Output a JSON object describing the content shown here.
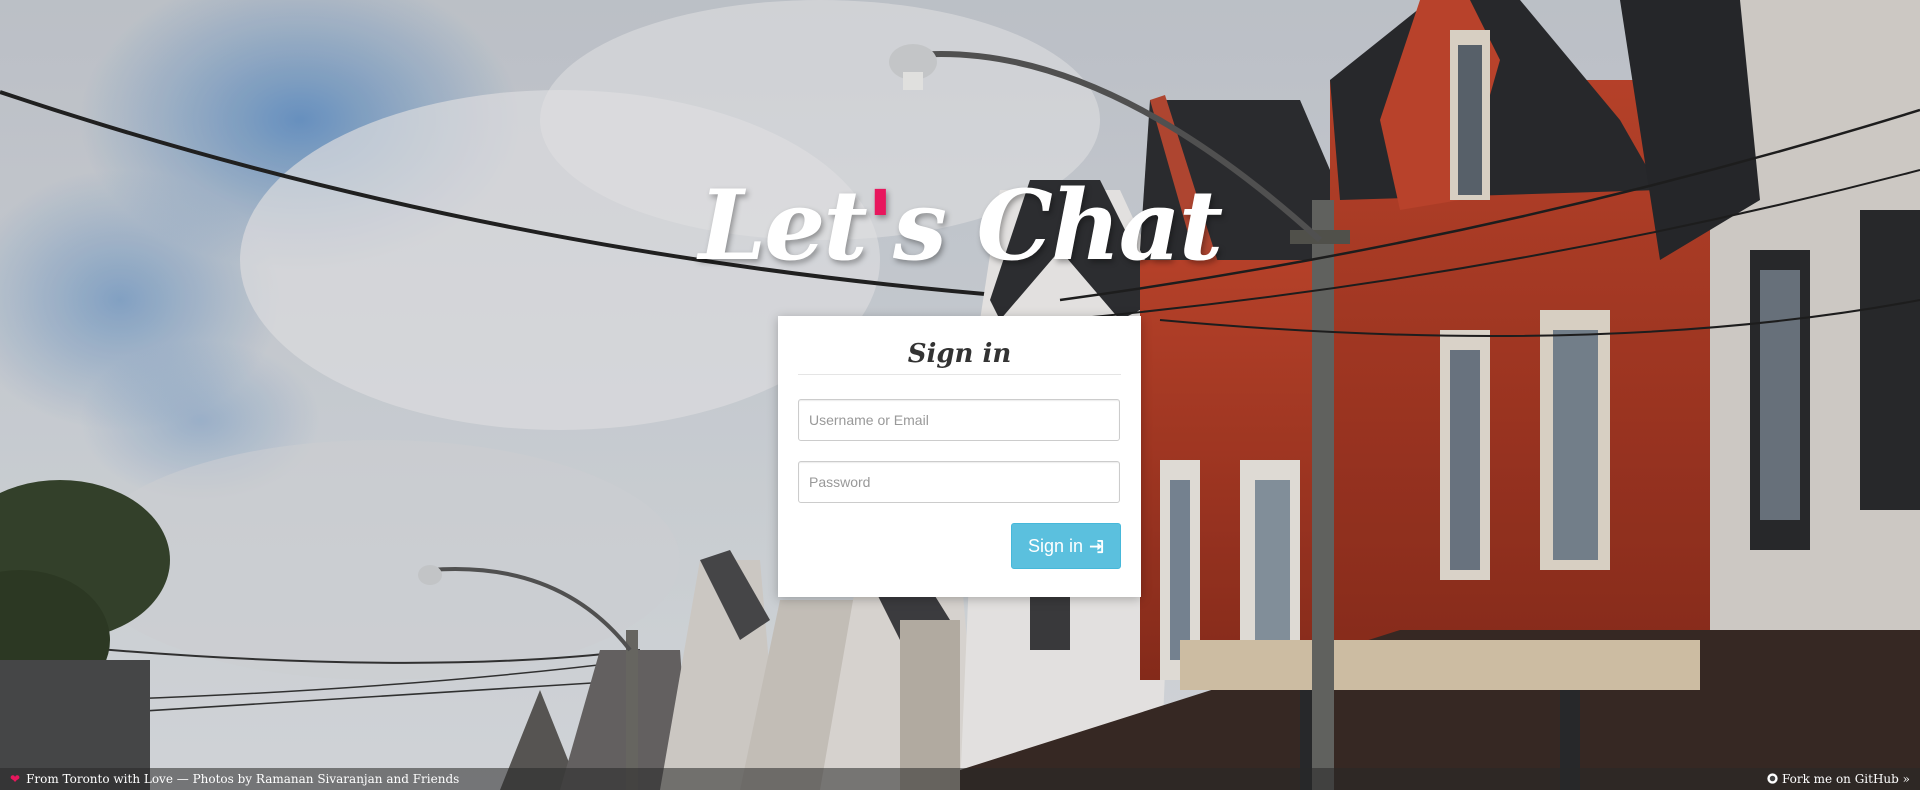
{
  "brand": {
    "logo_before": "Let",
    "logo_apostrophe": "'",
    "logo_after": "s Chat",
    "accent_color": "#e8175d"
  },
  "signin": {
    "title": "Sign in",
    "username_placeholder": "Username or Email",
    "password_placeholder": "Password",
    "button_label": "Sign in",
    "button_icon": "sign-in-icon",
    "button_color": "#5bc0de"
  },
  "footer": {
    "left_icon": "heart-icon",
    "left_text": "From Toronto with Love — Photos by Ramanan Sivaranjan and Friends",
    "right_icon": "github-icon",
    "right_text": "Fork me on GitHub »"
  }
}
